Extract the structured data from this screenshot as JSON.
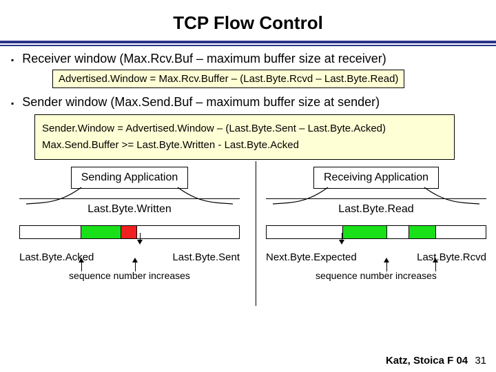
{
  "title": "TCP Flow Control",
  "bullets": {
    "receiver": "Receiver window (Max.Rcv.Buf – maximum buffer size at receiver)",
    "sender": "Sender window (Max.Send.Buf – maximum buffer size at sender)"
  },
  "formulas": {
    "advertised": "Advertised.Window = Max.Rcv.Buffer – (Last.Byte.Rcvd – Last.Byte.Read)",
    "sender_window": "Sender.Window = Advertised.Window – (Last.Byte.Sent – Last.Byte.Acked)",
    "max_send": "Max.Send.Buffer >= Last.Byte.Written - Last.Byte.Acked"
  },
  "diagram": {
    "left": {
      "app": "Sending Application",
      "mid_label": "Last.Byte.Written",
      "below_left": "Last.Byte.Acked",
      "below_right": "Last.Byte.Sent",
      "seq_note": "sequence number increases"
    },
    "right": {
      "app": "Receiving Application",
      "mid_label": "Last.Byte.Read",
      "below_left": "Next.Byte.Expected",
      "below_right": "Last.Byte.Rcvd",
      "seq_note": "sequence number increases"
    }
  },
  "footer": {
    "credit": "Katz, Stoica F 04",
    "page": "31"
  }
}
